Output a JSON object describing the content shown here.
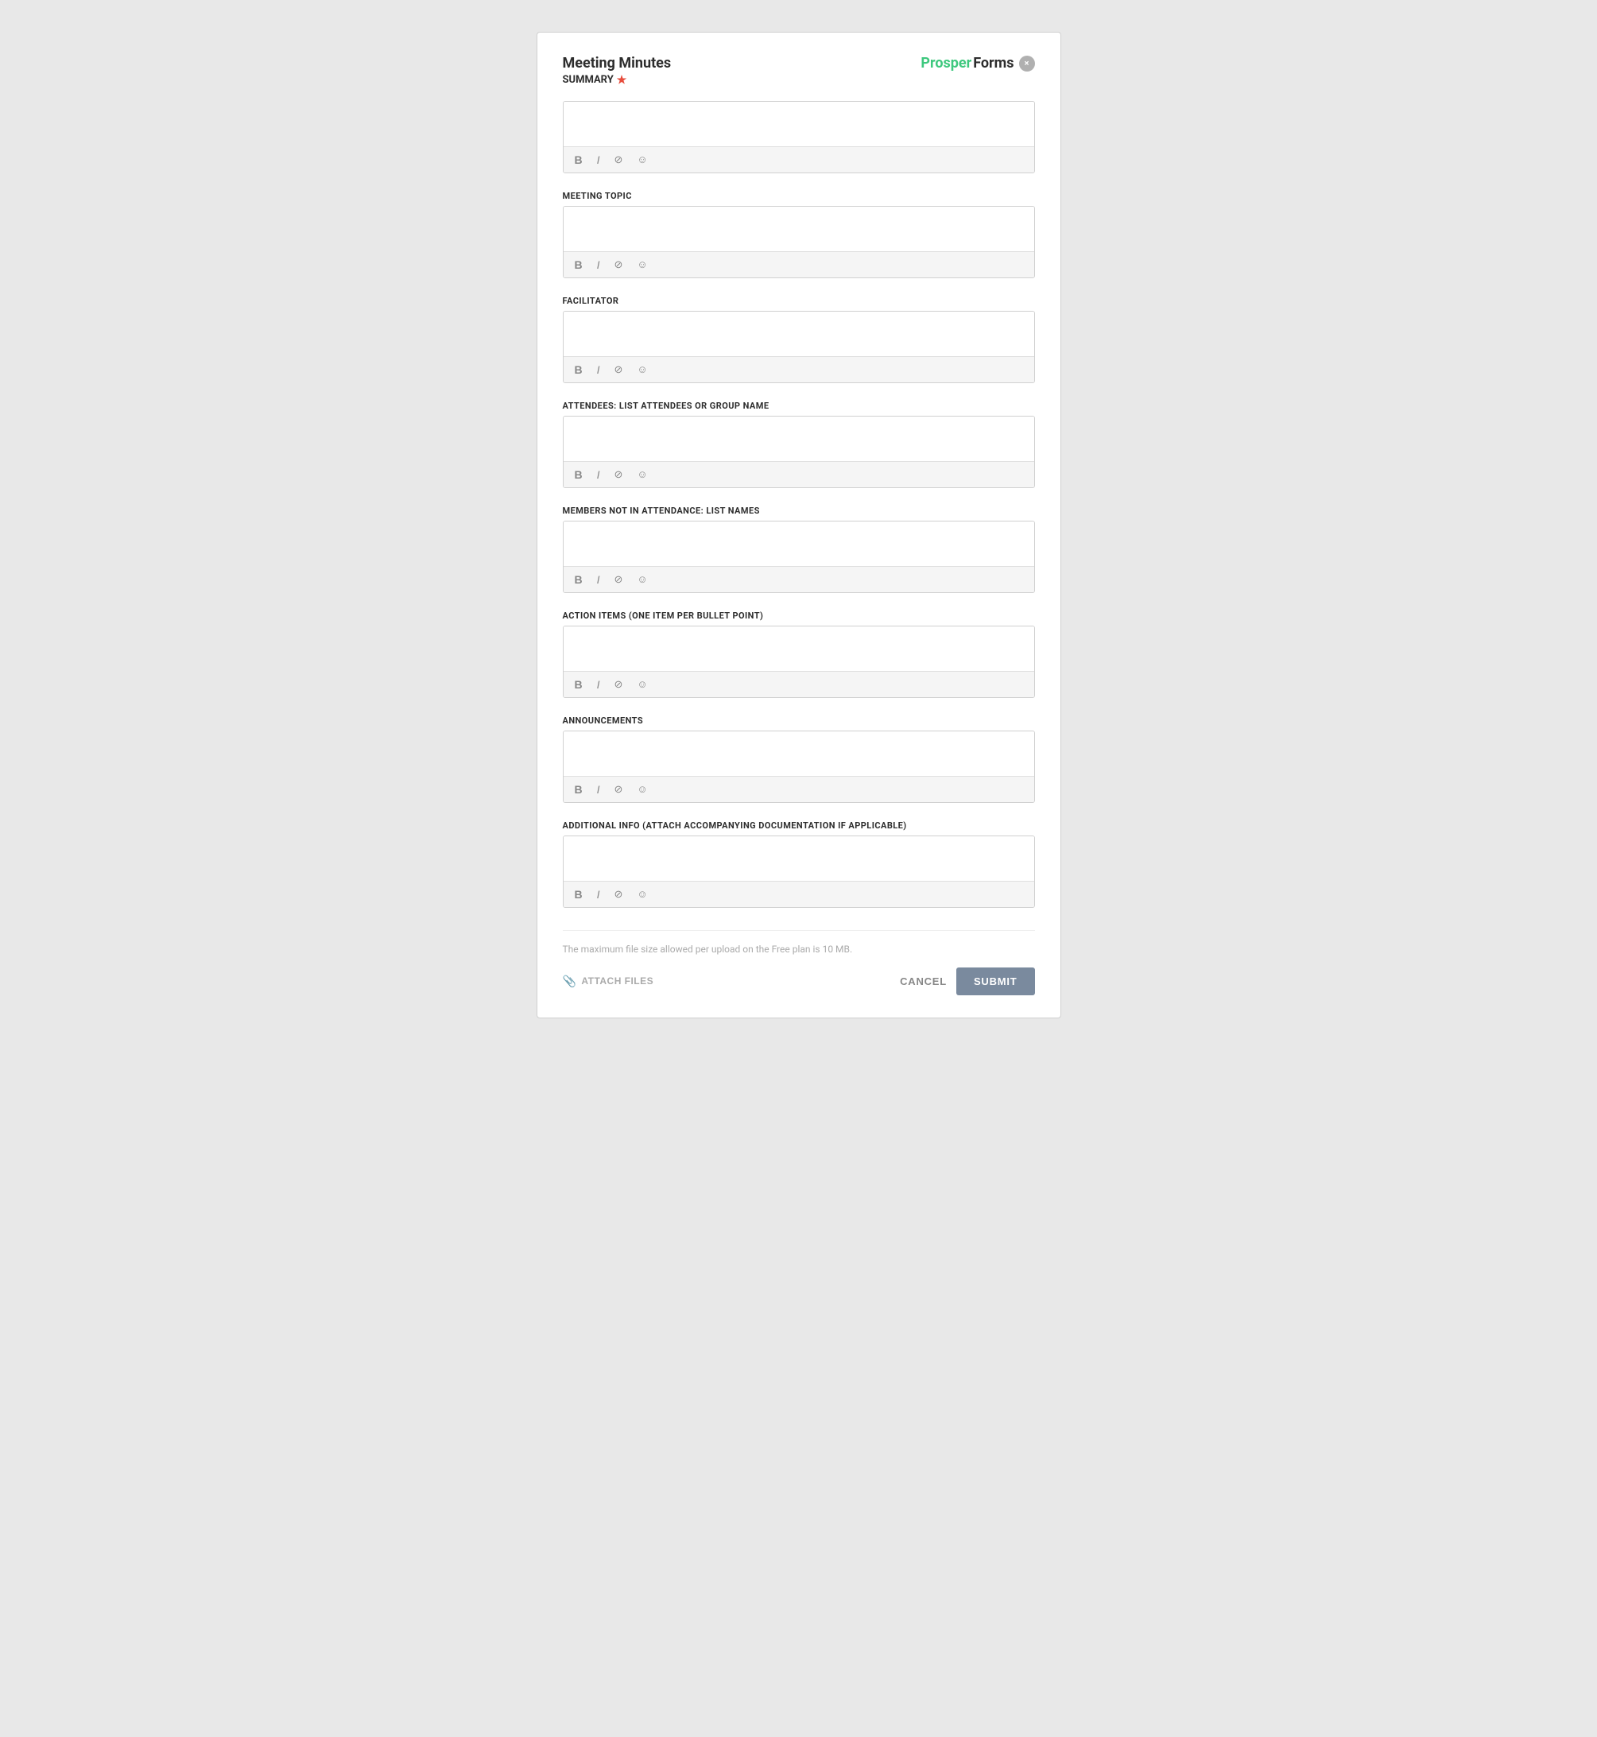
{
  "header": {
    "title": "Meeting Minutes",
    "subtitle": "SUMMARY",
    "required_indicator": "★",
    "logo_prosper": "Prosper",
    "logo_forms": "Forms",
    "close_label": "×"
  },
  "fields": [
    {
      "id": "summary",
      "label": "SUMMARY",
      "required": true,
      "toolbar": [
        "B",
        "I",
        "🔗",
        "🙂"
      ]
    },
    {
      "id": "meeting_topic",
      "label": "MEETING TOPIC",
      "required": false,
      "toolbar": [
        "B",
        "I",
        "🔗",
        "🙂"
      ]
    },
    {
      "id": "facilitator",
      "label": "FACILITATOR",
      "required": false,
      "toolbar": [
        "B",
        "I",
        "🔗",
        "🙂"
      ]
    },
    {
      "id": "attendees",
      "label": "ATTENDEES: LIST ATTENDEES OR GROUP NAME",
      "required": false,
      "toolbar": [
        "B",
        "I",
        "🔗",
        "🙂"
      ]
    },
    {
      "id": "members_not_attending",
      "label": "MEMBERS NOT IN ATTENDANCE: LIST NAMES",
      "required": false,
      "toolbar": [
        "B",
        "I",
        "🔗",
        "🙂"
      ]
    },
    {
      "id": "action_items",
      "label": "ACTION ITEMS (ONE ITEM PER BULLET POINT)",
      "required": false,
      "toolbar": [
        "B",
        "I",
        "🔗",
        "🙂"
      ]
    },
    {
      "id": "announcements",
      "label": "ANNOUNCEMENTS",
      "required": false,
      "toolbar": [
        "B",
        "I",
        "🔗",
        "🙂"
      ]
    },
    {
      "id": "additional_info",
      "label": "ADDITIONAL INFO (ATTACH ACCOMPANYING DOCUMENTATION IF APPLICABLE)",
      "required": false,
      "toolbar": [
        "B",
        "I",
        "🔗",
        "🙂"
      ]
    }
  ],
  "footer": {
    "file_size_note": "The maximum file size allowed per upload on the Free plan is 10 MB.",
    "attach_label": "ATTACH FILES",
    "cancel_label": "CANCEL",
    "submit_label": "SUBMIT"
  }
}
